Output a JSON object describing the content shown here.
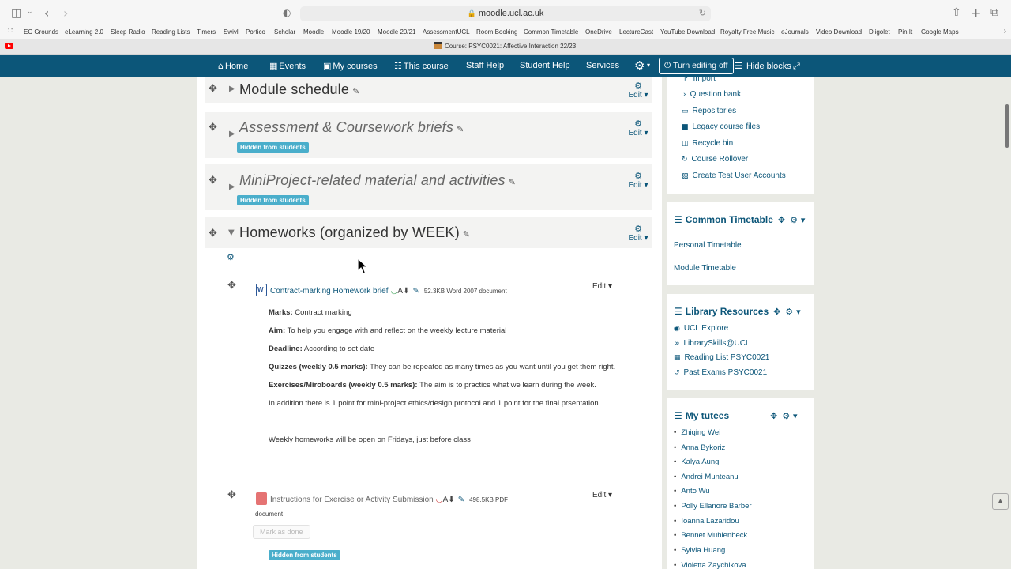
{
  "browser": {
    "url": "moodle.ucl.ac.uk",
    "bookmarks": [
      "EC Grounds",
      "eLearning 2.0",
      "Sleep Radio",
      "Reading Lists",
      "Timers",
      "Swivl",
      "Portico",
      "Scholar",
      "Moodle",
      "Moodle 19/20",
      "Moodle 20/21",
      "AssessmentUCL",
      "Room Booking",
      "Common Timetable",
      "OneDrive",
      "LectureCast",
      "YouTube Download",
      "Royalty Free Music",
      "eJournals",
      "Video Download",
      "Diigolet",
      "Pin It",
      "Google Maps"
    ],
    "active_tab": "Course: PSYC0021: Affective Interaction 22/23"
  },
  "nav": {
    "home": "Home",
    "events": "Events",
    "my_courses": "My courses",
    "this_course": "This course",
    "staff_help": "Staff Help",
    "student_help": "Student Help",
    "services": "Services",
    "editing": "Turn editing off",
    "hide_blocks": "Hide blocks"
  },
  "sections": [
    {
      "title": "Module schedule",
      "edit": "Edit",
      "hidden": false
    },
    {
      "title": "Assessment & Coursework briefs",
      "edit": "Edit",
      "hidden": true,
      "badge": "Hidden from students"
    },
    {
      "title": "MiniProject-related material and activities",
      "edit": "Edit",
      "hidden": true,
      "badge": "Hidden from students"
    },
    {
      "title": "Homeworks (organized by WEEK)",
      "edit": "Edit",
      "hidden": false
    }
  ],
  "activities": [
    {
      "title": "Contract-marking Homework brief",
      "size": "52.3KB Word 2007 document",
      "edit": "Edit",
      "marks_label": "Marks:",
      "marks": "Contract marking",
      "aim_label": "Aim:",
      "aim": "To help you engage with and reflect on the weekly lecture material",
      "deadline_label": "Deadline:",
      "deadline": "According to set date",
      "quizzes_label": "Quizzes (weekly 0.5 marks):",
      "quizzes": "They can be repeated as many times as you want until you get them right.",
      "exercises_label": "Exercises/Miroboards (weekly 0.5 marks):",
      "exercises": "The aim is to practice what we learn during the week.",
      "addition": "In addition there is 1 point for mini-project ethics/design protocol and 1 point for the final prsentation",
      "weekly": "Weekly homeworks will be open on Fridays, just before class"
    },
    {
      "title": "Instructions for Exercise or Activity Submission",
      "size": "498.5KB PDF",
      "size2": "document",
      "edit": "Edit",
      "mark_done": "Mark as done",
      "badge": "Hidden from students"
    }
  ],
  "admin_block": {
    "items": [
      "Import",
      "Question bank",
      "Repositories",
      "Legacy course files",
      "Recycle bin",
      "Course Rollover",
      "Create Test User Accounts"
    ]
  },
  "timetable_block": {
    "title": "Common Timetable",
    "links": [
      "Personal Timetable",
      "Module Timetable"
    ]
  },
  "library_block": {
    "title": "Library Resources",
    "links": [
      "UCL Explore",
      "LibrarySkills@UCL",
      "Reading List PSYC0021",
      "Past Exams PSYC0021"
    ]
  },
  "tutees_block": {
    "title": "My tutees",
    "names": [
      "Zhiqing Wei",
      "Anna Bykoriz",
      "Kalya Aung",
      "Andrei Munteanu",
      "Anto Wu",
      "Polly Ellanore Barber",
      "Ioanna Lazaridou",
      "Bennet Muhlenbeck",
      "Sylvia Huang",
      "Violetta Zaychikova"
    ]
  },
  "colors": {
    "navbar": "#0c5679",
    "badge": "#4aaecb",
    "link": "#0c5679"
  }
}
